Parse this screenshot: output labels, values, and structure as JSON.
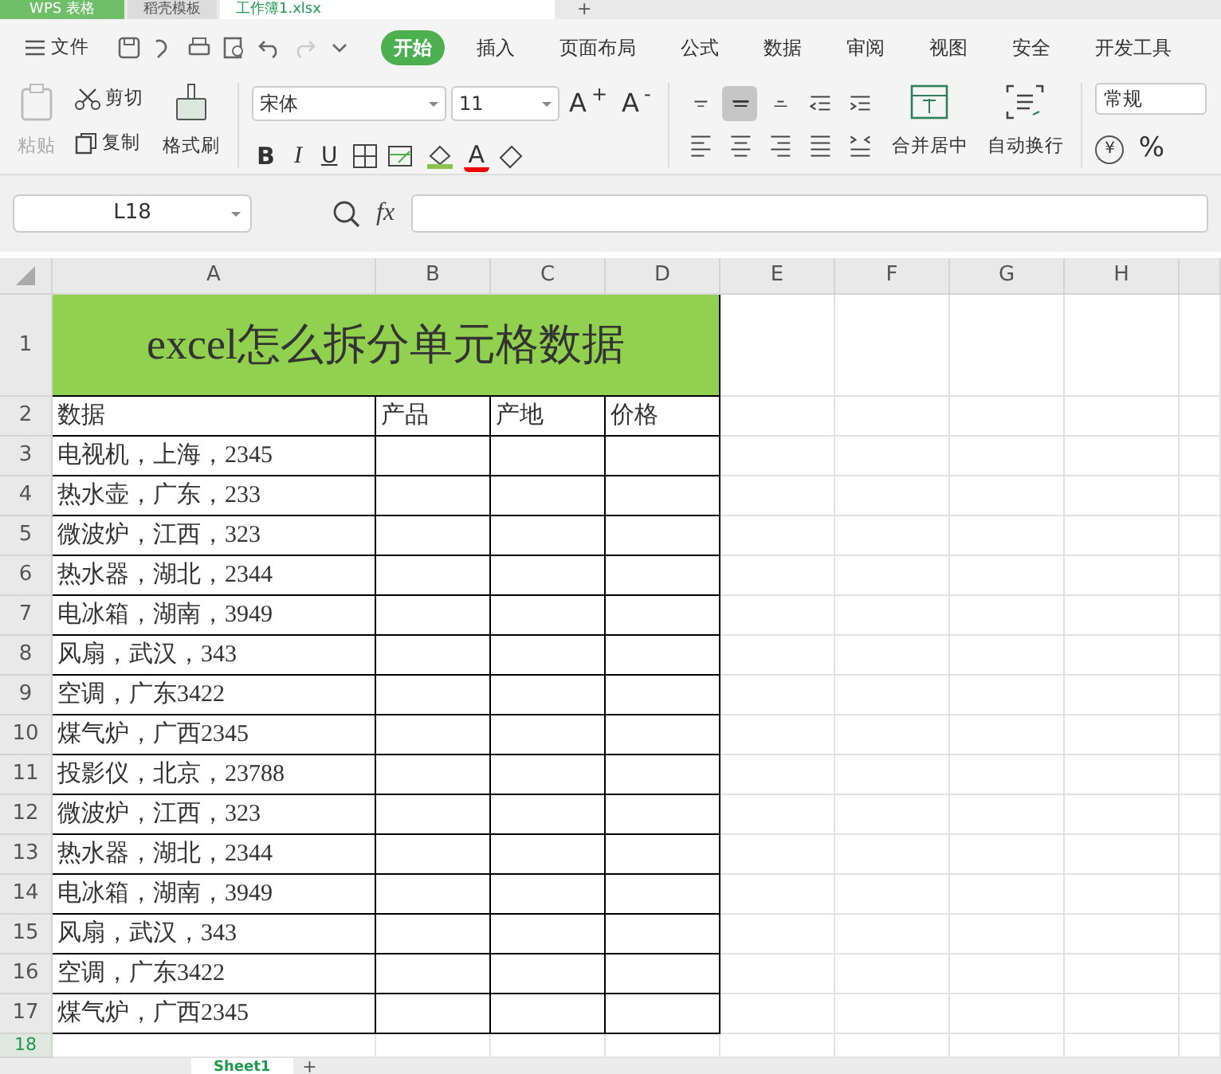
{
  "doc_tabs": [
    {
      "label": "WPS 表格",
      "kind": "app",
      "selected": false
    },
    {
      "label": "稻壳模板",
      "kind": "store",
      "selected": false
    },
    {
      "label": "工作簿1.xlsx",
      "kind": "file",
      "selected": true
    }
  ],
  "new_tab": "+",
  "menu": {
    "file": "文件",
    "tabs": [
      {
        "label": "开始",
        "selected": true
      },
      {
        "label": "插入",
        "selected": false
      },
      {
        "label": "页面布局",
        "selected": false
      },
      {
        "label": "公式",
        "selected": false
      },
      {
        "label": "数据",
        "selected": false
      },
      {
        "label": "审阅",
        "selected": false
      },
      {
        "label": "视图",
        "selected": false
      },
      {
        "label": "安全",
        "selected": false
      },
      {
        "label": "开发工具",
        "selected": false
      }
    ]
  },
  "ribbon": {
    "paste": "粘贴",
    "cut": "剪切",
    "copy": "复制",
    "painter": "格式刷",
    "font_name": "宋体",
    "font_size": "11",
    "grow": "A$^{+}$",
    "shrink": "A$^{-}$",
    "bold": "B",
    "italic": "I",
    "underline": "U",
    "font_color": "A",
    "align_buttons": [
      {
        "kind": "top",
        "selected": false
      },
      {
        "kind": "middle",
        "selected": true
      },
      {
        "kind": "bottom",
        "selected": false
      },
      {
        "kind": "outdent",
        "selected": false
      },
      {
        "kind": "indent",
        "selected": false
      },
      {
        "kind": "left",
        "selected": false
      },
      {
        "kind": "center",
        "selected": false
      },
      {
        "kind": "right",
        "selected": false
      },
      {
        "kind": "justify",
        "selected": false
      },
      {
        "kind": "distributed",
        "selected": false
      }
    ],
    "merge": "合并居中",
    "wrap": "自动换行",
    "number_format": "常规",
    "currency": "¥",
    "percent": "%"
  },
  "name_box": "L18",
  "fx": "fx",
  "columns": [
    "A",
    "B",
    "C",
    "D",
    "E",
    "F",
    "G",
    "H"
  ],
  "title_row": {
    "header": "1",
    "title": "excel怎么拆分单元格数据"
  },
  "rows": [
    {
      "header": "2",
      "cells": [
        "数据",
        "产品",
        "产地",
        "价格"
      ]
    },
    {
      "header": "3",
      "cells": [
        "电视机，上海，2345",
        "",
        "",
        ""
      ]
    },
    {
      "header": "4",
      "cells": [
        "热水壶，广东，233",
        "",
        "",
        ""
      ]
    },
    {
      "header": "5",
      "cells": [
        "微波炉，江西，323",
        "",
        "",
        ""
      ]
    },
    {
      "header": "6",
      "cells": [
        "热水器，湖北，2344",
        "",
        "",
        ""
      ]
    },
    {
      "header": "7",
      "cells": [
        "电冰箱，湖南，3949",
        "",
        "",
        ""
      ]
    },
    {
      "header": "8",
      "cells": [
        "风扇，武汉，343",
        "",
        "",
        ""
      ]
    },
    {
      "header": "9",
      "cells": [
        "空调，广东3422",
        "",
        "",
        ""
      ]
    },
    {
      "header": "10",
      "cells": [
        "煤气炉，广西2345",
        "",
        "",
        ""
      ]
    },
    {
      "header": "11",
      "cells": [
        "投影仪，北京，23788",
        "",
        "",
        ""
      ]
    },
    {
      "header": "12",
      "cells": [
        "微波炉，江西，323",
        "",
        "",
        ""
      ]
    },
    {
      "header": "13",
      "cells": [
        "热水器，湖北，2344",
        "",
        "",
        ""
      ]
    },
    {
      "header": "14",
      "cells": [
        "电冰箱，湖南，3949",
        "",
        "",
        ""
      ]
    },
    {
      "header": "15",
      "cells": [
        "风扇，武汉，343",
        "",
        "",
        ""
      ]
    },
    {
      "header": "16",
      "cells": [
        "空调，广东3422",
        "",
        "",
        ""
      ]
    },
    {
      "header": "17",
      "cells": [
        "煤气炉，广西2345",
        "",
        "",
        ""
      ]
    }
  ],
  "active_row": {
    "header": "18",
    "selected": true
  },
  "sheet_tabs": [
    {
      "label": "Sheet1",
      "selected": true
    }
  ],
  "add_sheet": "+"
}
